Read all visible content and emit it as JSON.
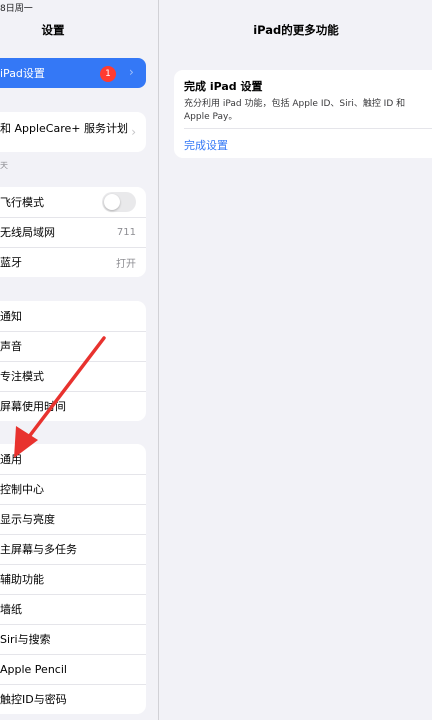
{
  "status_bar": {
    "time": "8日周一"
  },
  "sidebar": {
    "title": "设置",
    "selected_row": {
      "label": "iPad设置",
      "badge": "1"
    },
    "applecare": {
      "label": "和 AppleCare+ 服务计划"
    },
    "section_hint": "天",
    "network_rows": [
      {
        "label": "飞行模式",
        "toggle_on": false
      },
      {
        "label": "无线局域网",
        "value": "711"
      },
      {
        "label": "蓝牙",
        "value": "打开"
      }
    ],
    "notification_rows": [
      {
        "label": "通知"
      },
      {
        "label": "声音"
      },
      {
        "label": "专注模式"
      },
      {
        "label": "屏幕使用时间"
      }
    ],
    "general_rows": [
      {
        "label": "通用"
      },
      {
        "label": "控制中心"
      },
      {
        "label": "显示与亮度"
      },
      {
        "label": "主屏幕与多任务"
      },
      {
        "label": "辅助功能"
      },
      {
        "label": "墙纸"
      },
      {
        "label": "Siri与搜索"
      },
      {
        "label": "Apple Pencil"
      },
      {
        "label": "触控ID与密码"
      }
    ]
  },
  "detail": {
    "title": "iPad的更多功能",
    "card": {
      "title": "完成 iPad 设置",
      "description": "充分利用 iPad 功能，包括 Apple ID、Siri、触控 ID 和 Apple Pay。",
      "link": "完成设置"
    }
  },
  "colors": {
    "accent": "#3478f6",
    "annotation_arrow": "#e8322e",
    "badge": "#ff3b30"
  }
}
